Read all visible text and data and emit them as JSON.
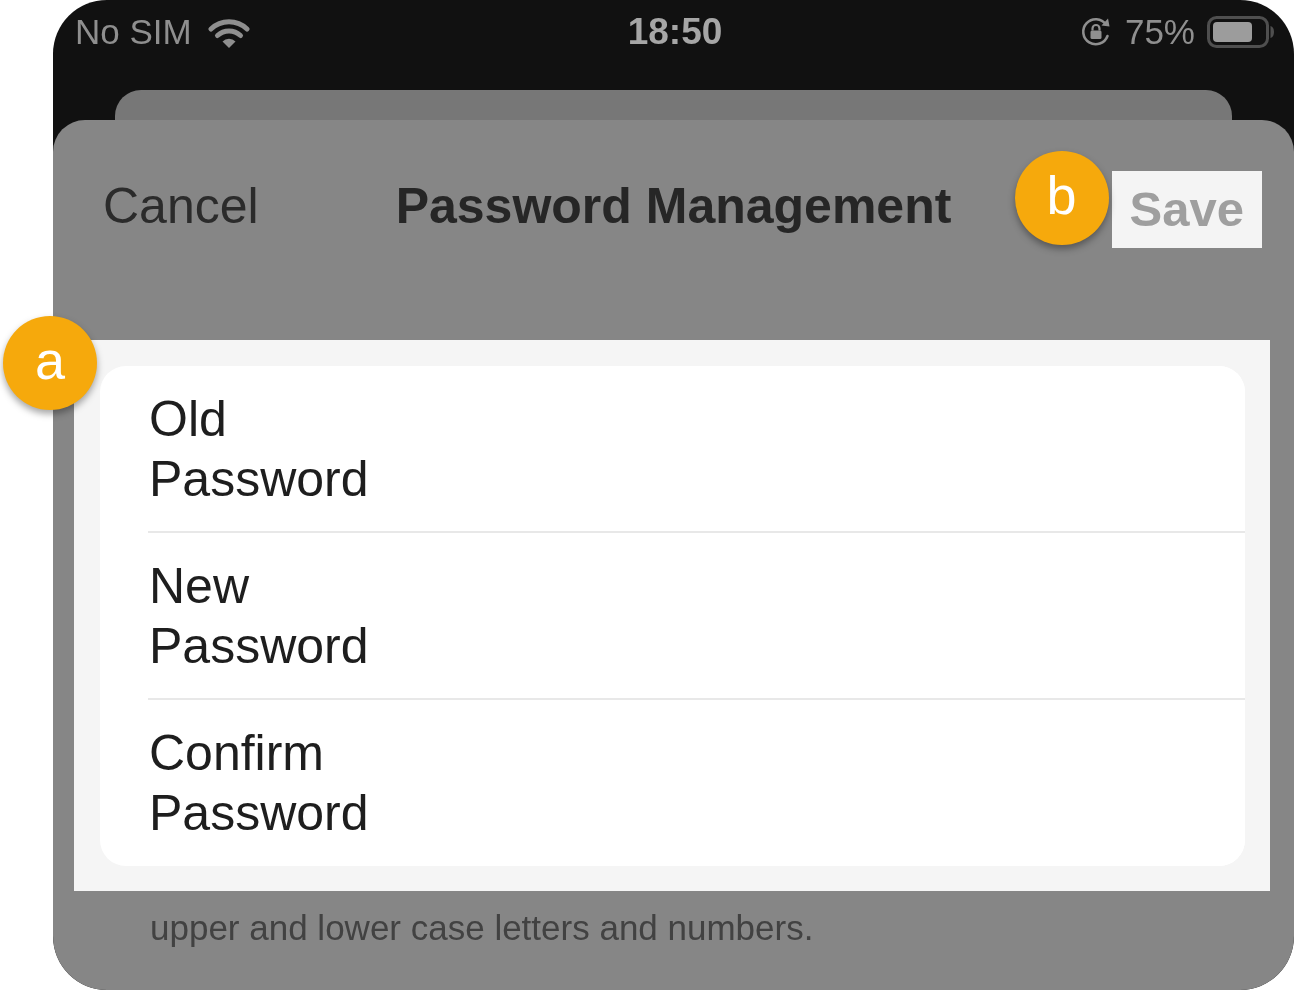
{
  "status_bar": {
    "carrier": "No SIM",
    "time": "18:50",
    "battery": "75%"
  },
  "nav_bar": {
    "cancel": "Cancel",
    "title": "Password Management",
    "save": {
      "label": "Save",
      "disabled": true,
      "highlighted": true,
      "callout": "b"
    }
  },
  "form": {
    "highlighted": true,
    "callout": "a",
    "fields": [
      {
        "label": "Old Password"
      },
      {
        "label": "New Password"
      },
      {
        "label": "Confirm Password"
      }
    ]
  },
  "hint": "upper and lower case letters and numbers."
}
